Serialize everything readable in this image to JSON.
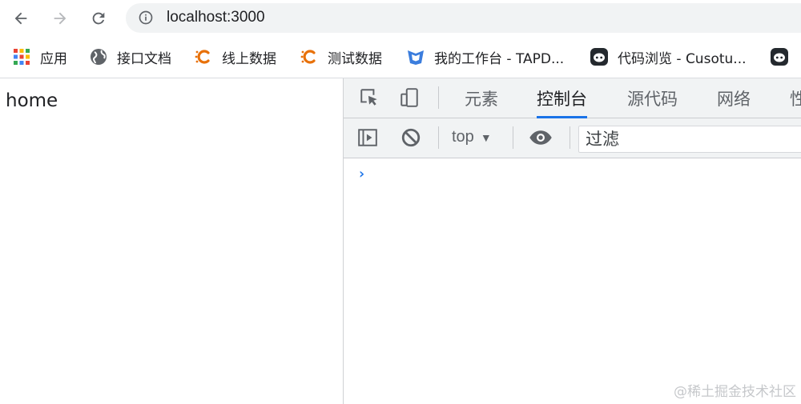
{
  "browser": {
    "url": "localhost:3000",
    "bookmarks": [
      {
        "label": "应用",
        "icon": "apps-grid-icon"
      },
      {
        "label": "接口文档",
        "icon": "globe-icon"
      },
      {
        "label": "线上数据",
        "icon": "c-logo-icon"
      },
      {
        "label": "测试数据",
        "icon": "c-logo-icon"
      },
      {
        "label": "我的工作台 - TAPD...",
        "icon": "tapd-logo-icon"
      },
      {
        "label": "代码浏览 - Cusotu...",
        "icon": "octocat-icon"
      }
    ]
  },
  "page": {
    "content_text": "home"
  },
  "devtools": {
    "tabs": [
      "元素",
      "控制台",
      "源代码",
      "网络",
      "性"
    ],
    "active_tab": "控制台",
    "context": "top",
    "filter_placeholder": "过滤",
    "prompt_symbol": "›"
  },
  "watermark": "@稀土掘金技术社区",
  "colors": {
    "accent_blue": "#1a73e8",
    "toolbar_bg": "#f1f3f4",
    "bm_orange": "#e8710a"
  }
}
